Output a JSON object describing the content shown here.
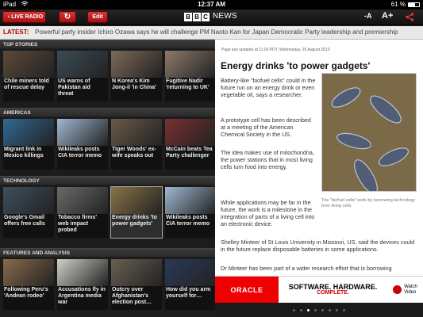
{
  "status": {
    "device": "iPad",
    "time": "12:37 AM",
    "battery": "61 %"
  },
  "toolbar": {
    "live_label": "LIVE RADIO",
    "refresh_glyph": "↻",
    "edit_label": "Edit",
    "logo_letters": [
      "B",
      "B",
      "C"
    ],
    "news": "NEWS",
    "font_small": "-A",
    "font_big": "A+"
  },
  "ticker": {
    "label": "LATEST:",
    "text": "Powerful party insider Ichiro Ozawa says he will challenge PM Naoto Kan for Japan Democratic Party leadership and premiership"
  },
  "sections": [
    {
      "title": "TOP STORIES",
      "items": [
        {
          "caption": "Chile miners told of rescue delay",
          "color": "#5b4a3a",
          "selected": false
        },
        {
          "caption": "US warns of Pakistan aid threat",
          "color": "#3c4b55",
          "selected": false
        },
        {
          "caption": "N Korea's Kim Jong-il 'in China'",
          "color": "#7c6a5a",
          "selected": false
        },
        {
          "caption": "Fugitive Nadir 'returning to UK'",
          "color": "#8d7a6a",
          "selected": false
        }
      ]
    },
    {
      "title": "AMERICAS",
      "items": [
        {
          "caption": "Migrant link in Mexico killings",
          "color": "#2f6a95",
          "selected": false
        },
        {
          "caption": "Wikileaks posts CIA terror memo",
          "color": "#9fb8d2",
          "selected": false
        },
        {
          "caption": "Tiger Woods' ex-wife speaks out",
          "color": "#6b5a4a",
          "selected": false
        },
        {
          "caption": "McCain beats Tea Party challenger",
          "color": "#7a3030",
          "selected": false
        }
      ]
    },
    {
      "title": "TECHNOLOGY",
      "items": [
        {
          "caption": "Google's Gmail offers free calls",
          "color": "#3d5060",
          "selected": false
        },
        {
          "caption": "Tobacco firms' web impact probed",
          "color": "#6a6a6a",
          "selected": false
        },
        {
          "caption": "Energy drinks 'to power gadgets'",
          "color": "#8a7448",
          "selected": true
        },
        {
          "caption": "Wikileaks posts CIA terror memo",
          "color": "#9fb8d2",
          "selected": false
        }
      ]
    },
    {
      "title": "FEATURES AND ANALYSIS",
      "items": [
        {
          "caption": "Following Peru's 'Andean rodeo'",
          "color": "#8a6a4a",
          "selected": false
        },
        {
          "caption": "Accusations fly in Argentina media war",
          "color": "#d0d0c8",
          "selected": false
        },
        {
          "caption": "Outcry over Afghanistan's election post…",
          "color": "#6a6052",
          "selected": false
        },
        {
          "caption": "How did you arm yourself for…",
          "color": "#2a3a5a",
          "selected": false
        }
      ]
    }
  ],
  "article": {
    "updated": "Page last updated at 11:03 PDT, Wednesday, 25 August 2010",
    "title": "Energy drinks 'to power gadgets'",
    "paragraphs": [
      "Battery-like \"biofuel cells\" could in the future run on an energy drink or even vegetable oil, says a researcher.",
      "A prototype cell has been described at a meeting of the American Chemical Society in the US.",
      "The idea makes use of mitochondria, the power stations that in most living cells turn food into energy.",
      "While applications may be far in the future, the work is a milestone in the integration of parts of a living cell into an electronic device.",
      "Shelley Minteer of St Louis University in Missouri, US, said the devices could in the future replace disposable batteries in some applications.",
      "Dr Minteer has been part of a wider research effort that is borrowing"
    ],
    "caption": "The \"biofuel cells\" work by borrowing technology from living cells"
  },
  "ad": {
    "brand": "ORACLE",
    "line1": "SOFTWARE. HARDWARE.",
    "line2": "COMPLETE.",
    "watch1": "Watch",
    "watch2": "Video"
  },
  "pager": {
    "count": 8,
    "active": 2
  }
}
